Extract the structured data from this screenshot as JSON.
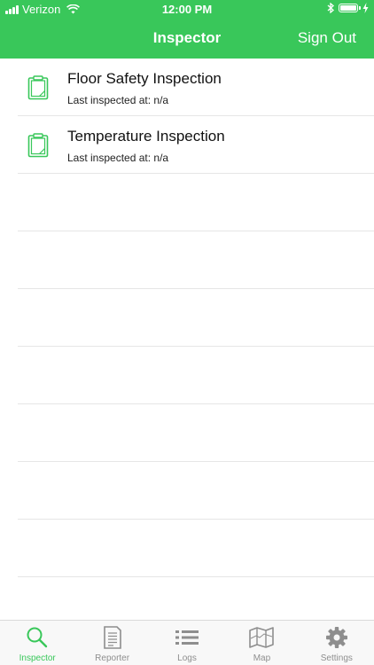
{
  "status_bar": {
    "carrier": "Verizon",
    "time": "12:00 PM"
  },
  "nav": {
    "title": "Inspector",
    "sign_out": "Sign Out"
  },
  "inspections": [
    {
      "title": "Floor Safety Inspection",
      "subtitle": "Last inspected at: n/a"
    },
    {
      "title": "Temperature Inspection",
      "subtitle": "Last inspected at: n/a"
    }
  ],
  "tabs": [
    {
      "label": "Inspector",
      "icon": "search-icon",
      "active": true
    },
    {
      "label": "Reporter",
      "icon": "document-icon",
      "active": false
    },
    {
      "label": "Logs",
      "icon": "list-icon",
      "active": false
    },
    {
      "label": "Map",
      "icon": "map-icon",
      "active": false
    },
    {
      "label": "Settings",
      "icon": "gear-icon",
      "active": false
    }
  ],
  "colors": {
    "accent": "#39c75a",
    "tab_inactive": "#8e8e8e"
  }
}
